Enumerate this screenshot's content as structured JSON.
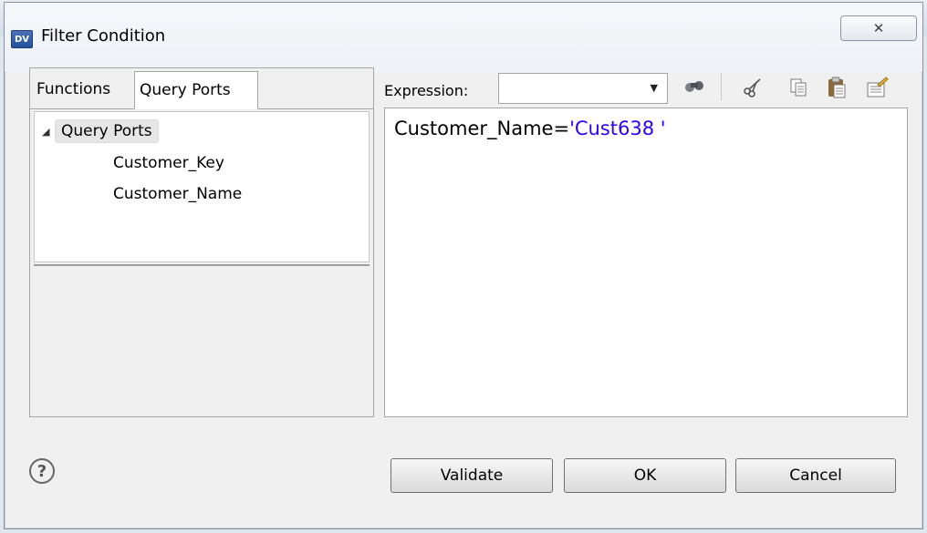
{
  "window": {
    "title": "Filter Condition",
    "app_icon_text": "DV",
    "close_glyph": "✕"
  },
  "left_panel": {
    "tabs": [
      {
        "label": "Functions"
      },
      {
        "label": "Query Ports"
      }
    ],
    "active_tab": "Query Ports",
    "tree": {
      "root_label": "Query Ports",
      "children": [
        "Customer_Key",
        "Customer_Name"
      ]
    }
  },
  "expression": {
    "label": "Expression:",
    "combo_value": "",
    "text_prefix": "Customer_Name=",
    "text_string": "'Cust638 '"
  },
  "toolbar": {
    "icons": [
      "find-icon",
      "cut-icon",
      "copy-icon",
      "paste-icon",
      "clear-icon"
    ]
  },
  "buttons": {
    "validate": "Validate",
    "ok": "OK",
    "cancel": "Cancel",
    "help_glyph": "?"
  },
  "colors": {
    "string_literal": "#2a00ff"
  }
}
